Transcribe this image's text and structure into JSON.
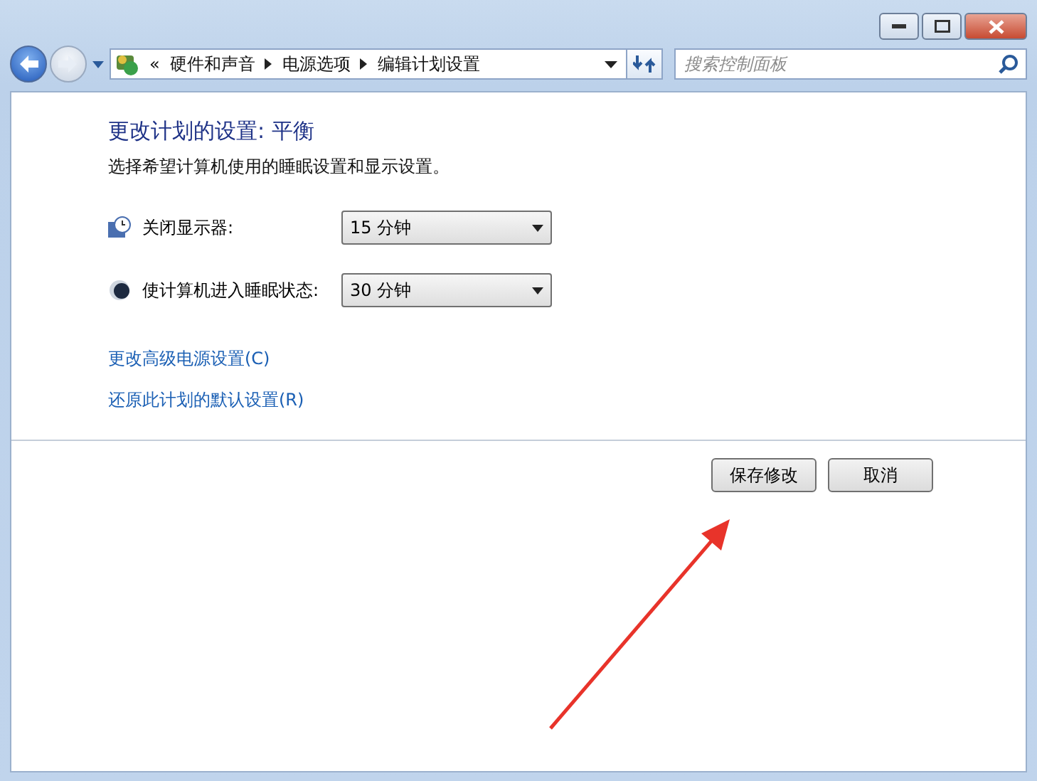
{
  "address_bar": {
    "overflow": "«",
    "breadcrumbs": [
      "硬件和声音",
      "电源选项",
      "编辑计划设置"
    ]
  },
  "search": {
    "placeholder": "搜索控制面板"
  },
  "heading": "更改计划的设置: 平衡",
  "description": "选择希望计算机使用的睡眠设置和显示设置。",
  "settings": [
    {
      "kind": "display",
      "label": "关闭显示器:",
      "value": "15 分钟"
    },
    {
      "kind": "sleep",
      "label": "使计算机进入睡眠状态:",
      "value": "30 分钟"
    }
  ],
  "links": [
    "更改高级电源设置(C)",
    "还原此计划的默认设置(R)"
  ],
  "buttons": [
    "保存修改",
    "取消"
  ]
}
